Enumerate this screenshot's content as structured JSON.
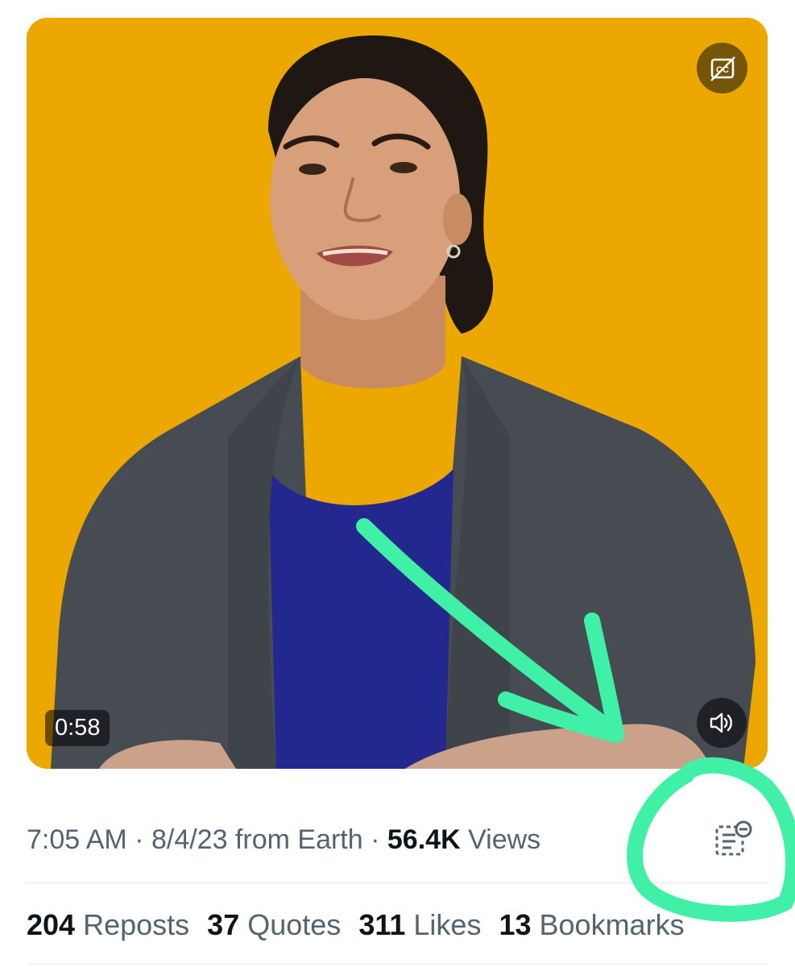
{
  "video": {
    "duration": "0:58",
    "captions_icon": "captions-off-icon",
    "sound_icon": "speaker-icon",
    "background_color": "#eda800"
  },
  "meta": {
    "time": "7:05 AM",
    "sep1": " · ",
    "date": "8/4/23",
    "source": " from Earth",
    "sep2": " · ",
    "views_count": "56.4K",
    "views_label": " Views",
    "notes_icon": "community-notes-icon"
  },
  "stats": [
    {
      "count": "204",
      "label": "Reposts"
    },
    {
      "count": "37",
      "label": "Quotes"
    },
    {
      "count": "311",
      "label": "Likes"
    },
    {
      "count": "13",
      "label": "Bookmarks"
    }
  ],
  "annotation": {
    "color": "#3ff0a6",
    "shapes": [
      "arrow",
      "circle"
    ]
  }
}
